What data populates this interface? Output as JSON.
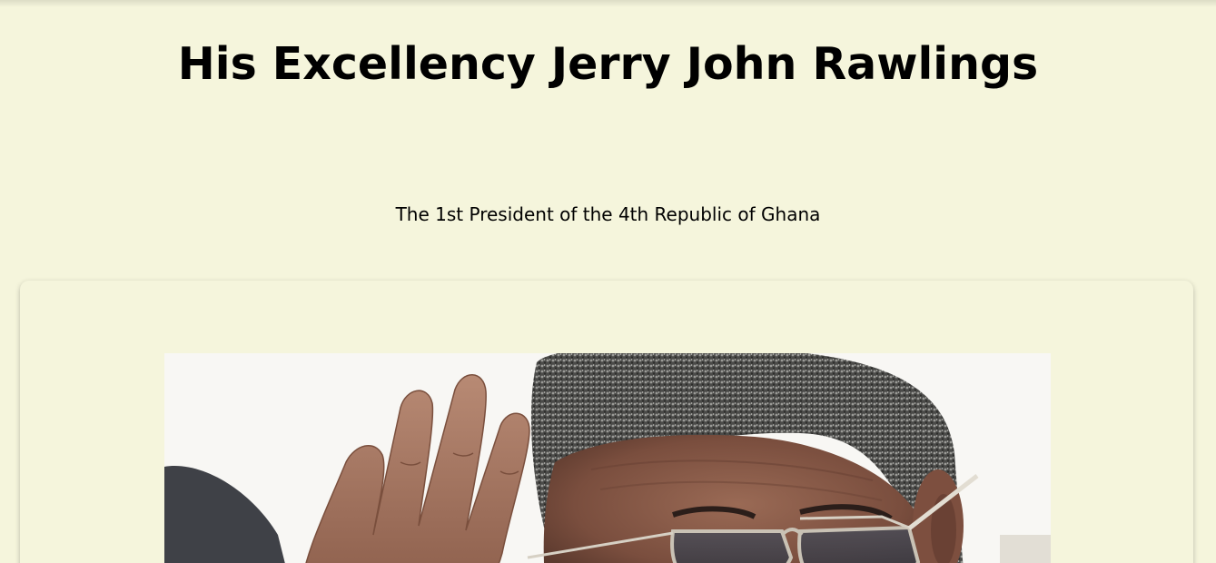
{
  "header": {
    "title": "His Excellency Jerry John Rawlings",
    "subtitle": "The 1st President of the 4th Republic of Ghana"
  },
  "portrait": {
    "alt": "Portrait photo of Jerry John Rawlings saluting"
  },
  "colors": {
    "page_background": "#f5f5dc",
    "text": "#000000"
  }
}
